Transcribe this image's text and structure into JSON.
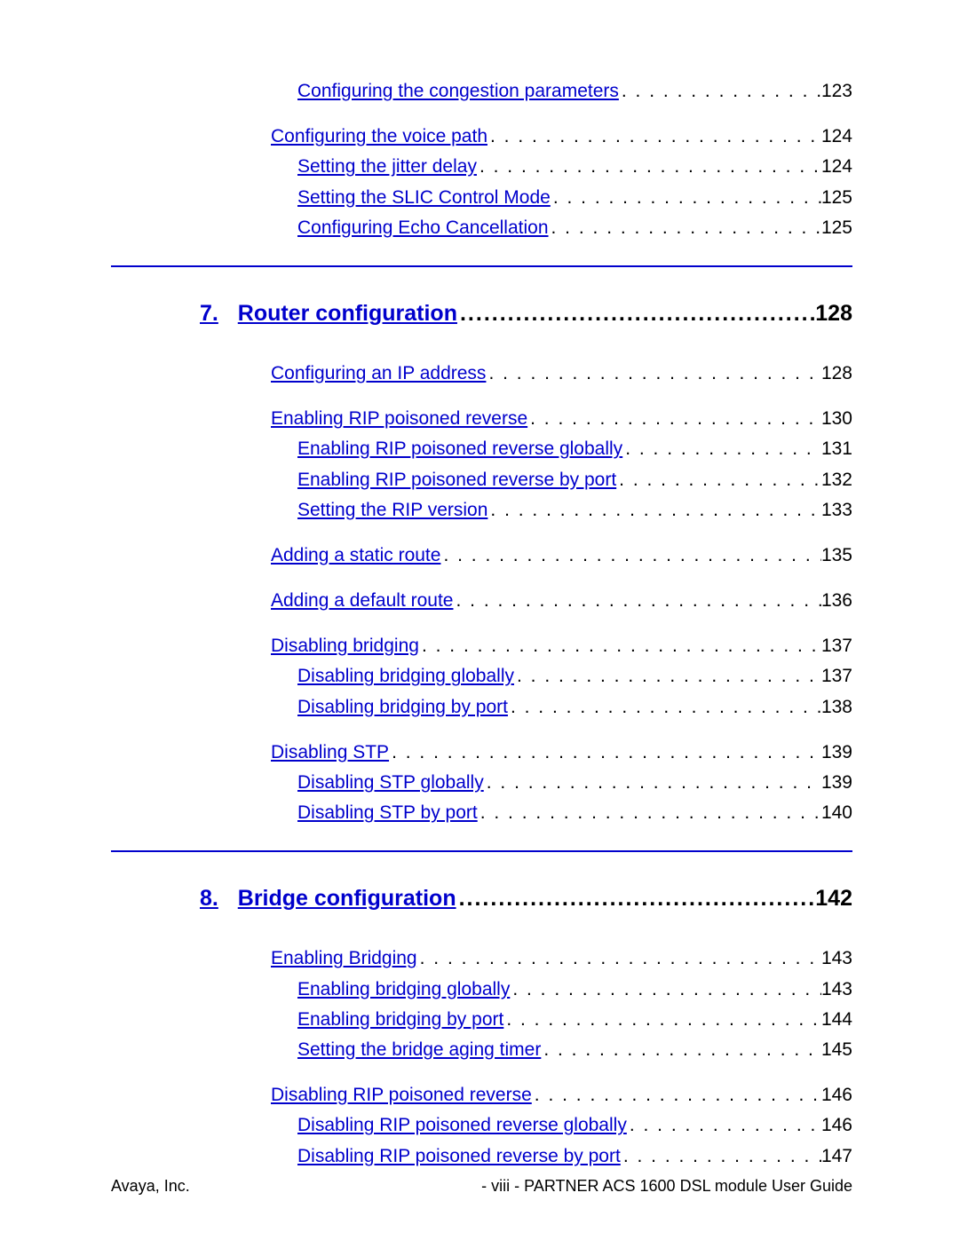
{
  "intro_group": [
    {
      "title": "Configuring the congestion parameters",
      "page": "123",
      "indent": 2
    }
  ],
  "voice_group": [
    {
      "title": "Configuring the voice path",
      "page": "124",
      "indent": 1
    },
    {
      "title": "Setting the jitter delay",
      "page": "124",
      "indent": 2
    },
    {
      "title": "Setting the SLIC Control Mode",
      "page": "125",
      "indent": 2
    },
    {
      "title": "Configuring Echo Cancellation",
      "page": "125",
      "indent": 2
    }
  ],
  "section7": {
    "num": "7.",
    "title": "Router configuration",
    "page": "128"
  },
  "s7_groups": [
    [
      {
        "title": "Configuring an IP address",
        "page": "128",
        "indent": 1
      }
    ],
    [
      {
        "title": "Enabling RIP poisoned reverse",
        "page": "130",
        "indent": 1
      },
      {
        "title": "Enabling RIP poisoned reverse globally",
        "page": "131",
        "indent": 2
      },
      {
        "title": "Enabling RIP poisoned reverse by port",
        "page": "132",
        "indent": 2
      },
      {
        "title": "Setting the RIP version",
        "page": "133",
        "indent": 2
      }
    ],
    [
      {
        "title": "Adding a static route",
        "page": "135",
        "indent": 1
      }
    ],
    [
      {
        "title": "Adding a default route",
        "page": "136",
        "indent": 1
      }
    ],
    [
      {
        "title": "Disabling bridging",
        "page": "137",
        "indent": 1
      },
      {
        "title": "Disabling bridging globally",
        "page": "137",
        "indent": 2
      },
      {
        "title": "Disabling bridging by port",
        "page": "138",
        "indent": 2
      }
    ],
    [
      {
        "title": "Disabling STP",
        "page": "139",
        "indent": 1
      },
      {
        "title": "Disabling STP globally",
        "page": "139",
        "indent": 2
      },
      {
        "title": "Disabling STP by port",
        "page": "140",
        "indent": 2
      }
    ]
  ],
  "section8": {
    "num": "8.",
    "title": "Bridge configuration",
    "page": "142"
  },
  "s8_groups": [
    [
      {
        "title": "Enabling Bridging",
        "page": "143",
        "indent": 1
      },
      {
        "title": "Enabling bridging globally",
        "page": "143",
        "indent": 2
      },
      {
        "title": "Enabling bridging by port",
        "page": "144",
        "indent": 2
      },
      {
        "title": "Setting the bridge aging timer",
        "page": "145",
        "indent": 2
      }
    ],
    [
      {
        "title": "Disabling RIP poisoned reverse",
        "page": "146",
        "indent": 1
      },
      {
        "title": "Disabling RIP poisoned reverse globally",
        "page": "146",
        "indent": 2
      },
      {
        "title": "Disabling RIP poisoned reverse by port",
        "page": "147",
        "indent": 2
      }
    ]
  ],
  "footer": {
    "left": "Avaya, Inc.",
    "right": "- viii -  PARTNER ACS 1600 DSL module User Guide"
  }
}
